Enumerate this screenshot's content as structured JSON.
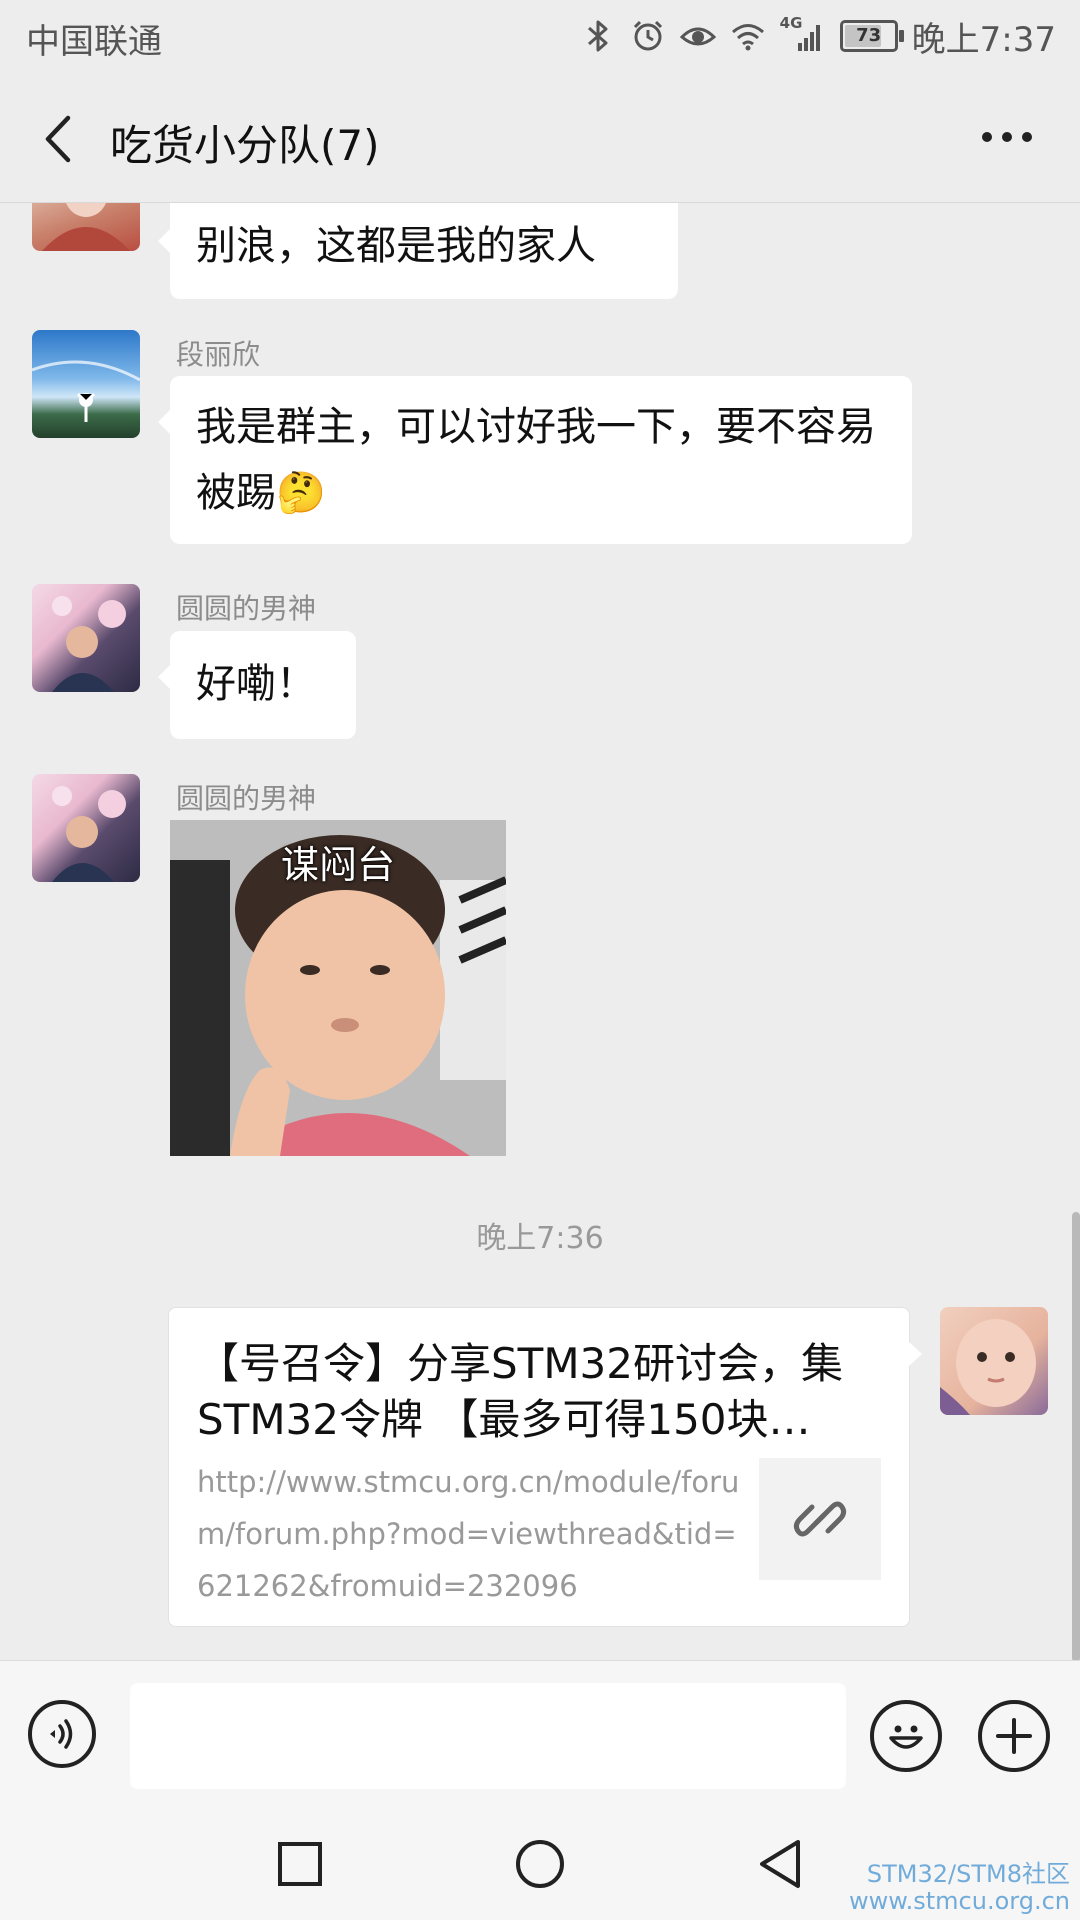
{
  "status_bar": {
    "carrier": "中国联通",
    "network": "4G",
    "battery": "73",
    "time": "晚上7:37"
  },
  "header": {
    "title": "吃货小分队(7)"
  },
  "messages": [
    {
      "type": "text",
      "sender": "",
      "text": "别浪，这都是我的家人"
    },
    {
      "type": "text",
      "sender": "段丽欣",
      "text": "我是群主，可以讨好我一下，要不容易被踢🤔"
    },
    {
      "type": "text",
      "sender": "圆圆的男神",
      "text": "好嘞！"
    },
    {
      "type": "sticker",
      "sender": "圆圆的男神",
      "caption": "谋闷台"
    }
  ],
  "timestamp": "晚上7:36",
  "link_message": {
    "title": "【号召令】分享STM32研讨会，集STM32令牌 【最多可得150块…",
    "url": "http://www.stmcu.org.cn/module/forum/forum.php?mod=viewthread&tid=621262&fromuid=232096",
    "icon": "link-icon"
  },
  "input": {
    "value": ""
  },
  "watermark": {
    "line1": "STM32/STM8社区",
    "line2": "www.stmcu.org.cn"
  },
  "colors": {
    "background": "#ededed",
    "bubble": "#ffffff",
    "meta_text": "#8c8c8c",
    "watermark": "#5a9fd6"
  }
}
